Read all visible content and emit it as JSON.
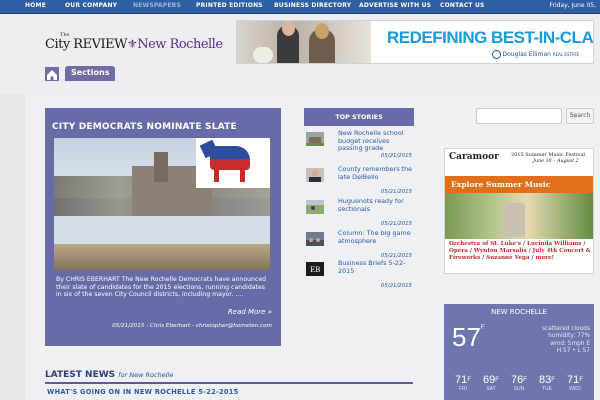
{
  "nav": {
    "items": [
      {
        "label": "HOME",
        "active": false
      },
      {
        "label": "OUR COMPANY",
        "active": false
      },
      {
        "label": "NEWSPAPERS",
        "active": true
      },
      {
        "label": "PRINTED EDITIONS",
        "active": false
      },
      {
        "label": "BUSINESS DIRECTORY",
        "active": false
      },
      {
        "label": "ADVERTISE WITH US",
        "active": false
      },
      {
        "label": "CONTACT US",
        "active": false
      }
    ],
    "date": "Friday, June 05,"
  },
  "logo": {
    "the": "The",
    "city_review": "City REVIEW",
    "fleur": "⚜",
    "new_rochelle": "New Rochelle"
  },
  "ad_banner": {
    "headline": "REDEFINING BEST-IN-CLASS.",
    "brand": "Douglas Elliman",
    "brand_sub": "REAL ESTATE"
  },
  "sections_tab": {
    "label": "Sections"
  },
  "feature": {
    "title": "CITY DEMOCRATS NOMINATE SLATE",
    "text": "By CHRIS EBERHART The New Rochelle Democrats have announced their slate of candidates for the 2015 elections, running candidates in six of the seven City Council districts, including mayor. ....",
    "read_more": "Read More »",
    "meta": "05/21/2015 - Chris Eberhart - christopher@hometen.com"
  },
  "top_stories": {
    "heading": "TOP STORIES",
    "items": [
      {
        "title": "New Rochelle school budget receives passing grade",
        "date": "05/21/2015",
        "thumb": "building-thumb"
      },
      {
        "title": "County remembers the late DelBello",
        "date": "05/21/2015",
        "thumb": "portrait-thumb"
      },
      {
        "title": "Huguenots ready for sectionals",
        "date": "05/21/2015",
        "thumb": "field-thumb"
      },
      {
        "title": "Column: The big game atmosphere",
        "date": "05/21/2015",
        "thumb": "crowd-thumb"
      },
      {
        "title": "Business Briefs 5-22-2015",
        "date": "05/21/2015",
        "thumb": "logo-thumb"
      }
    ]
  },
  "search": {
    "placeholder": "",
    "button": "Search"
  },
  "caramoor_ad": {
    "logo": "Caramoor",
    "festival": "2015 Summer Music Festival",
    "dates": "June 20 – August 2",
    "cta": "Explore Summer Music",
    "lineup": [
      "Orchestra of St. Luke's",
      "Lucinda Williams",
      "Opera",
      "Wynton Marsalis",
      "July 4th Concert & Fireworks",
      "Suzanne Vega",
      "more!"
    ]
  },
  "weather": {
    "city": "NEW ROCHELLE",
    "temp": "57",
    "unit": "F",
    "condition": "scattered clouds",
    "humidity": "humidity: 77%",
    "wind": "wind: 5mph E",
    "hilo": "H 57 • L 57",
    "forecast": [
      {
        "day": "FRI",
        "temp": "71"
      },
      {
        "day": "SAT",
        "temp": "69"
      },
      {
        "day": "SUN",
        "temp": "76"
      },
      {
        "day": "TUE",
        "temp": "83"
      },
      {
        "day": "WED",
        "temp": "71"
      }
    ]
  },
  "latest_news": {
    "title": "LATEST NEWS",
    "sub": "for New Rochelle",
    "first_item": "WHAT'S GOING ON IN NEW ROCHELLE 5-22-2015"
  }
}
